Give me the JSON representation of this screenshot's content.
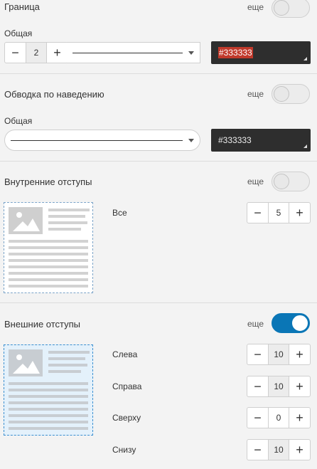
{
  "border": {
    "title": "Граница",
    "more": "еще",
    "toggle_on": false,
    "sub_label": "Общая",
    "width_value": "2",
    "minus": "−",
    "plus": "+",
    "color_value": "#333333"
  },
  "hover_outline": {
    "title": "Обводка по наведению",
    "more": "еще",
    "toggle_on": false,
    "sub_label": "Общая",
    "color_value": "#333333"
  },
  "padding": {
    "title": "Внутренние отступы",
    "more": "еще",
    "toggle_on": false,
    "all_label": "Все",
    "all_value": "5",
    "minus": "−",
    "plus": "+"
  },
  "margin": {
    "title": "Внешние отступы",
    "more": "еще",
    "toggle_on": true,
    "minus": "−",
    "plus": "+",
    "rows": [
      {
        "label": "Слева",
        "value": "10"
      },
      {
        "label": "Справа",
        "value": "10"
      },
      {
        "label": "Сверху",
        "value": "0"
      },
      {
        "label": "Снизу",
        "value": "10"
      }
    ]
  },
  "colors": {
    "accent": "#0a76b6",
    "dark_field": "#2e2e2e",
    "highlight": "#c0392b"
  }
}
